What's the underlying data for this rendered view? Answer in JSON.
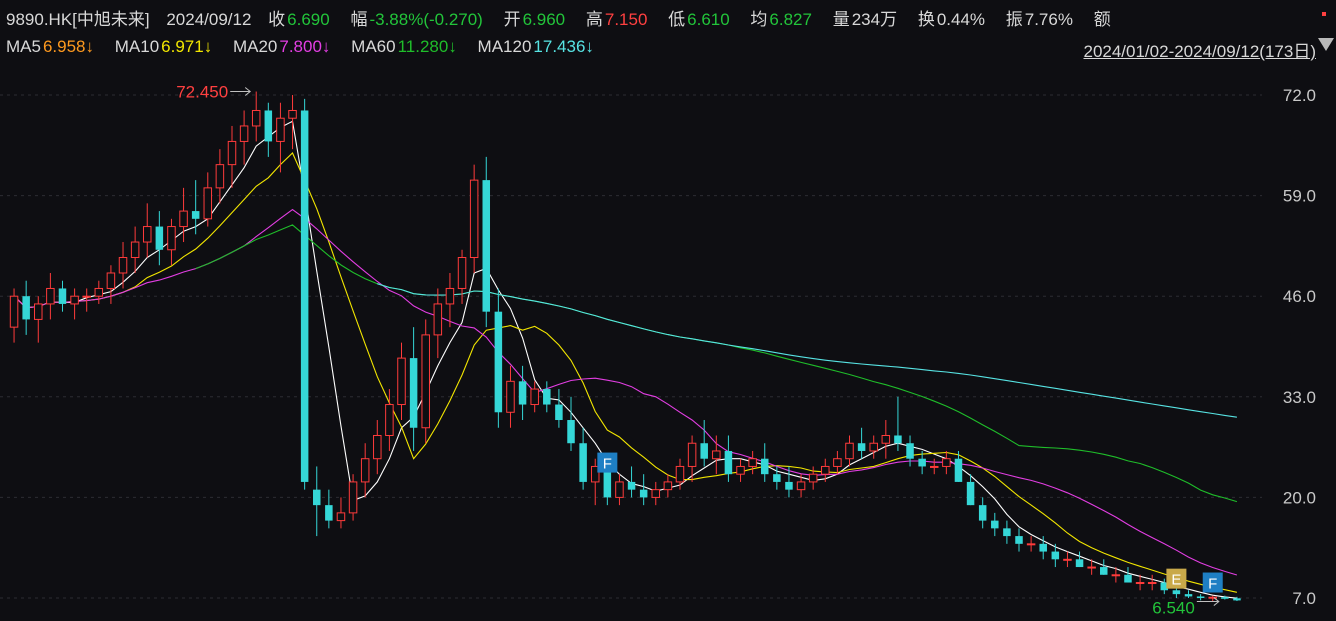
{
  "header": {
    "symbol": "9890.HK[中旭未来]",
    "date": "2024/09/12",
    "close_label": "收",
    "close": "6.690",
    "change_label": "幅",
    "change": "-3.88%(-0.270)",
    "open_label": "开",
    "open": "6.960",
    "high_label": "高",
    "high": "7.150",
    "low_label": "低",
    "low": "6.610",
    "avg_label": "均",
    "avg": "6.827",
    "volume_label": "量",
    "volume": "234万",
    "turnover_label": "换",
    "turnover": "0.44%",
    "amplitude_label": "振",
    "amplitude": "7.76%",
    "amount_label": "额"
  },
  "ma_row": {
    "ma5_label": "MA5",
    "ma5": "6.958↓",
    "ma10_label": "MA10",
    "ma10": "6.971↓",
    "ma20_label": "MA20",
    "ma20": "7.800↓",
    "ma60_label": "MA60",
    "ma60": "11.280↓",
    "ma120_label": "MA120",
    "ma120": "17.436↓",
    "date_range": "2024/01/02-2024/09/12(173日)"
  },
  "colors": {
    "up": "#ff3b3b",
    "down": "#35d7d7",
    "ma5": "#ffffff",
    "ma10": "#f2e600",
    "ma20": "#e23ee2",
    "ma60": "#1fbd2a",
    "ma120": "#57e3e3",
    "red_text": "#ff4040",
    "green_text": "#22c43a",
    "orange": "#ff9a1f",
    "marker_e": "#c9a94a",
    "marker_f": "#1e7fc4"
  },
  "chart_data": {
    "type": "candlestick",
    "x": "2024/01/02 - 2024/09/12 trading days",
    "ylim": [
      4.5,
      74
    ],
    "yticks": [
      "72.0",
      "59.0",
      "46.0",
      "33.0",
      "20.0",
      "7.0"
    ],
    "ohlc": [
      [
        42,
        47,
        40,
        46
      ],
      [
        46,
        48,
        41,
        43
      ],
      [
        43,
        46,
        40,
        45
      ],
      [
        45,
        49,
        43,
        47
      ],
      [
        47,
        48,
        44,
        45
      ],
      [
        45,
        47,
        43,
        46
      ],
      [
        46,
        47,
        44,
        46
      ],
      [
        46,
        48,
        45,
        47
      ],
      [
        47,
        50,
        45,
        49
      ],
      [
        49,
        53,
        47,
        51
      ],
      [
        51,
        55,
        49,
        53
      ],
      [
        53,
        58,
        51,
        55
      ],
      [
        55,
        57,
        50,
        52
      ],
      [
        52,
        56,
        50,
        55
      ],
      [
        55,
        60,
        53,
        57
      ],
      [
        57,
        61,
        54,
        56
      ],
      [
        56,
        62,
        55,
        60
      ],
      [
        60,
        65,
        58,
        63
      ],
      [
        63,
        68,
        60,
        66
      ],
      [
        66,
        70,
        63,
        68
      ],
      [
        68,
        72.45,
        66,
        70
      ],
      [
        70,
        71,
        64,
        66
      ],
      [
        66,
        71,
        62,
        69
      ],
      [
        69,
        72,
        65,
        70
      ],
      [
        70,
        71.5,
        21,
        22
      ],
      [
        21,
        24,
        15,
        19
      ],
      [
        19,
        21,
        16,
        17
      ],
      [
        17,
        20,
        16,
        18
      ],
      [
        18,
        23,
        17,
        22
      ],
      [
        22,
        27,
        20,
        25
      ],
      [
        25,
        30,
        23,
        28
      ],
      [
        28,
        34,
        26,
        32
      ],
      [
        32,
        40,
        30,
        38
      ],
      [
        38,
        42,
        26,
        29
      ],
      [
        29,
        43,
        27,
        41
      ],
      [
        41,
        47,
        38,
        45
      ],
      [
        45,
        49,
        42,
        47
      ],
      [
        47,
        52,
        45,
        51
      ],
      [
        51,
        63,
        49,
        61
      ],
      [
        61,
        64,
        42,
        44
      ],
      [
        44,
        47,
        29,
        31
      ],
      [
        31,
        37,
        29,
        35
      ],
      [
        35,
        37,
        30,
        32
      ],
      [
        32,
        35,
        31,
        34
      ],
      [
        34,
        35,
        31,
        32
      ],
      [
        32,
        34,
        29,
        30
      ],
      [
        30,
        33,
        26,
        27
      ],
      [
        27,
        29,
        21,
        22
      ],
      [
        22,
        25,
        19,
        24
      ],
      [
        24,
        25,
        19,
        20
      ],
      [
        20,
        23,
        19,
        22
      ],
      [
        22,
        24,
        20,
        21
      ],
      [
        21,
        23,
        19,
        20
      ],
      [
        20,
        22,
        19,
        21
      ],
      [
        21,
        23,
        20,
        22
      ],
      [
        22,
        25,
        21,
        24
      ],
      [
        24,
        28,
        22,
        27
      ],
      [
        27,
        30,
        24,
        25
      ],
      [
        25,
        28,
        23,
        26
      ],
      [
        26,
        28,
        22,
        23
      ],
      [
        23,
        25,
        22,
        24
      ],
      [
        24,
        26,
        23,
        25
      ],
      [
        25,
        27,
        22,
        23
      ],
      [
        23,
        24,
        21,
        22
      ],
      [
        22,
        24,
        20,
        21
      ],
      [
        21,
        23,
        20,
        22
      ],
      [
        22,
        24,
        21,
        23
      ],
      [
        23,
        25,
        22,
        24
      ],
      [
        24,
        26,
        23,
        25
      ],
      [
        25,
        28,
        24,
        27
      ],
      [
        27,
        29,
        25,
        26
      ],
      [
        26,
        28,
        25,
        27
      ],
      [
        27,
        30,
        25,
        28
      ],
      [
        28,
        33,
        26,
        27
      ],
      [
        27,
        28,
        24,
        25
      ],
      [
        25,
        26,
        23,
        24
      ],
      [
        24,
        25,
        23,
        24
      ],
      [
        24,
        26,
        23,
        25
      ],
      [
        25,
        26,
        22,
        22
      ],
      [
        22,
        23,
        19,
        19
      ],
      [
        19,
        20,
        16,
        17
      ],
      [
        17,
        18,
        15,
        16
      ],
      [
        16,
        17,
        14,
        15
      ],
      [
        15,
        16,
        13,
        14
      ],
      [
        14,
        15,
        13,
        14
      ],
      [
        14,
        15,
        12,
        13
      ],
      [
        13,
        14,
        11,
        12
      ],
      [
        12,
        13,
        11,
        12
      ],
      [
        12,
        13,
        11,
        11
      ],
      [
        11,
        12,
        10,
        11
      ],
      [
        11,
        12,
        10,
        10
      ],
      [
        10,
        11,
        9,
        10
      ],
      [
        10,
        11,
        9,
        9
      ],
      [
        9,
        10,
        8,
        9
      ],
      [
        9,
        10,
        8,
        9
      ],
      [
        9,
        9.5,
        7.5,
        8
      ],
      [
        8,
        8.5,
        7,
        7.5
      ],
      [
        7.5,
        8,
        7,
        7.2
      ],
      [
        7.2,
        7.5,
        6.7,
        7
      ],
      [
        7,
        7.3,
        6.6,
        7.1
      ],
      [
        7.1,
        7.3,
        6.8,
        6.9
      ],
      [
        6.96,
        7.15,
        6.61,
        6.69
      ]
    ],
    "ma5_last": 6.958,
    "ma10_last": 6.971,
    "ma20_last": 7.8,
    "ma60_last": 11.28,
    "ma120_last": 17.436,
    "annotations": [
      {
        "text": "72.450",
        "kind": "high"
      },
      {
        "text": "6.540",
        "kind": "low"
      },
      {
        "text": "F",
        "kind": "marker"
      },
      {
        "text": "E",
        "kind": "marker"
      },
      {
        "text": "F",
        "kind": "marker"
      }
    ]
  }
}
